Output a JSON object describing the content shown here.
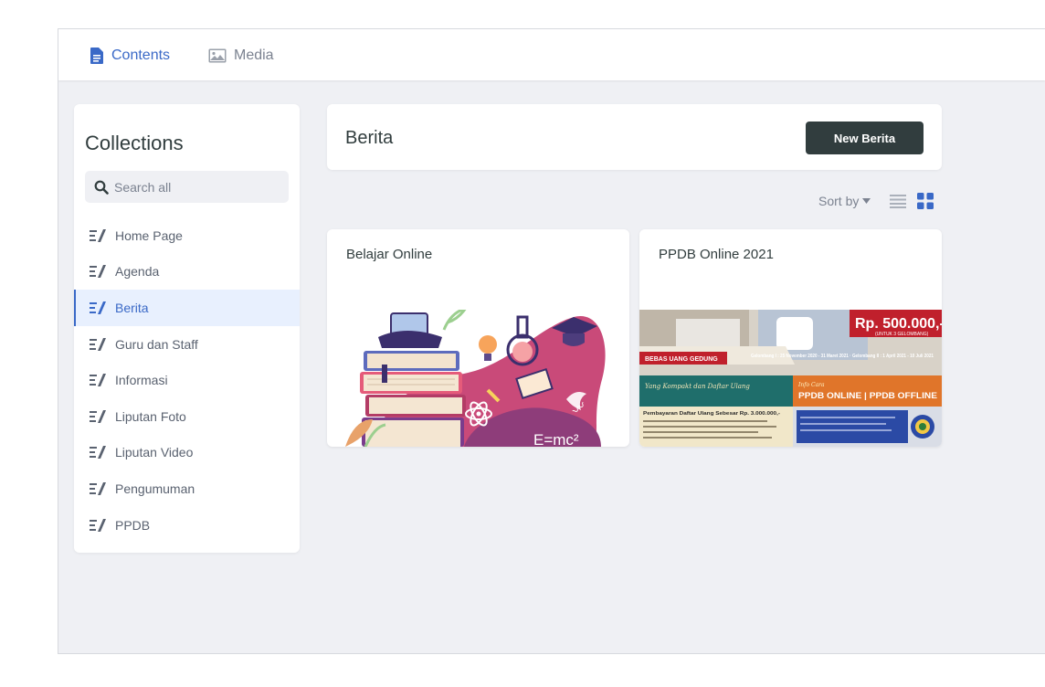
{
  "topnav": {
    "contents_label": "Contents",
    "media_label": "Media"
  },
  "sidebar": {
    "title": "Collections",
    "search_placeholder": "Search all",
    "items": [
      {
        "label": "Home Page"
      },
      {
        "label": "Agenda"
      },
      {
        "label": "Berita"
      },
      {
        "label": "Guru dan Staff"
      },
      {
        "label": "Informasi"
      },
      {
        "label": "Liputan Foto"
      },
      {
        "label": "Liputan Video"
      },
      {
        "label": "Pengumuman"
      },
      {
        "label": "PPDB"
      }
    ],
    "active_item": "Berita"
  },
  "main": {
    "collection_title": "Berita",
    "new_button_label": "New Berita",
    "sort_label": "Sort by",
    "cards": [
      {
        "title": "Belajar Online",
        "image": {
          "formula": "E=mc²"
        }
      },
      {
        "title": "PPDB Online 2021",
        "image": {
          "price": "Rp. 500.000,-",
          "price_note": "(UNTUK 3 GELOMBANG)",
          "banner_left": "BEBAS UANG GEDUNG",
          "wave_text": "Gelombang I : 25 November 2020 - 31 Maret 2021 · Gelombang II : 1 April 2021 - 10 Juli 2021",
          "mode_text": "PPDB ONLINE | PPDB OFFLINE",
          "script_text": "Yang Kompakt dan Daftar Ulang",
          "script_text2": "Info Cara",
          "fee_text": "Pembayaran Daftar Ulang Sebesar Rp. 3.000.000,-"
        }
      }
    ]
  },
  "colors": {
    "accent": "#3a69c7",
    "dark_button": "#313d3e",
    "background": "#eff0f4"
  }
}
